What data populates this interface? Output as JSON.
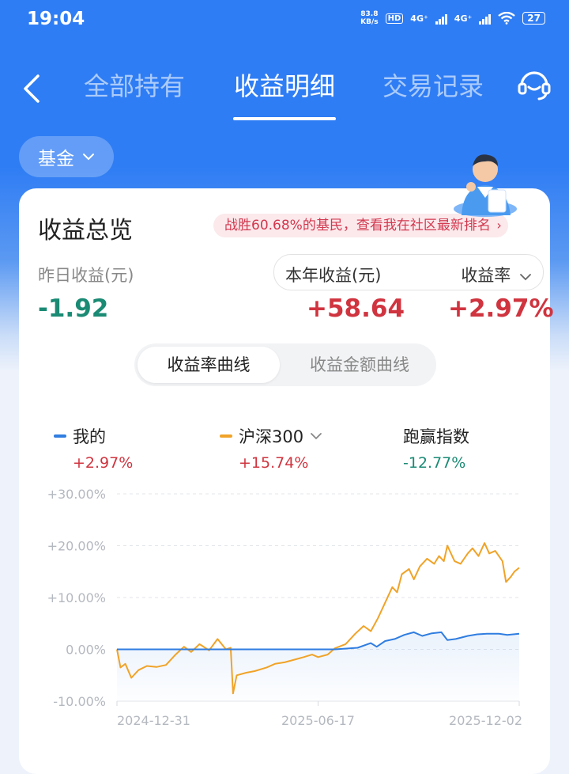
{
  "status_bar": {
    "time": "19:04",
    "net_speed_value": "83.8",
    "net_speed_unit": "KB/s",
    "hd_label": "HD",
    "sim1_label": "4G⁺",
    "sim2_label": "4G⁺",
    "battery": "27"
  },
  "nav": {
    "tabs": [
      {
        "label": "全部持有",
        "active": false
      },
      {
        "label": "收益明细",
        "active": true
      },
      {
        "label": "交易记录",
        "active": false
      }
    ]
  },
  "filter": {
    "label": "基金"
  },
  "overview": {
    "title": "收益总览",
    "rank_banner": "战胜60.68%的基民，查看我在社区最新排名",
    "yesterday_label": "昨日收益(元)",
    "yesterday_value": "-1.92",
    "year_label": "本年收益(元)",
    "rate_label": "收益率",
    "year_value": "+58.64",
    "rate_value": "+2.97%"
  },
  "curve_tabs": {
    "active": "收益率曲线",
    "inactive": "收益金额曲线"
  },
  "legend": [
    {
      "name": "我的",
      "value": "+2.97%",
      "color": "#2f7de1",
      "value_color": "#d0343f"
    },
    {
      "name": "沪深300",
      "value": "+15.74%",
      "color": "#f0a328",
      "value_color": "#d0343f"
    },
    {
      "name": "跑赢指数",
      "value": "-12.77%",
      "color": "",
      "value_color": "#1a8a74"
    }
  ],
  "chart_data": {
    "type": "line",
    "yticks": [
      "+30.00%",
      "+20.00%",
      "+10.00%",
      "0.00%",
      "-10.00%"
    ],
    "ylim": [
      -10,
      30
    ],
    "xticks": [
      "2024-12-31",
      "2025-06-17",
      "2025-12-02"
    ],
    "xrange": [
      "2024-12-31",
      "2025-12-02"
    ],
    "grid": true,
    "series": [
      {
        "name": "我的",
        "color": "#2f7de1",
        "points": [
          [
            "2024-12-31",
            0
          ],
          [
            "2025-07-01",
            0
          ],
          [
            "2025-07-20",
            0.3
          ],
          [
            "2025-07-31",
            1.2
          ],
          [
            "2025-08-05",
            0.5
          ],
          [
            "2025-08-12",
            1.6
          ],
          [
            "2025-08-20",
            2.0
          ],
          [
            "2025-08-28",
            2.8
          ],
          [
            "2025-09-05",
            3.3
          ],
          [
            "2025-09-12",
            2.6
          ],
          [
            "2025-09-20",
            3.1
          ],
          [
            "2025-09-28",
            3.3
          ],
          [
            "2025-10-03",
            1.8
          ],
          [
            "2025-10-10",
            2.0
          ],
          [
            "2025-10-20",
            2.6
          ],
          [
            "2025-10-28",
            2.9
          ],
          [
            "2025-11-05",
            3.0
          ],
          [
            "2025-11-15",
            3.0
          ],
          [
            "2025-11-22",
            2.8
          ],
          [
            "2025-12-02",
            3.0
          ]
        ]
      },
      {
        "name": "沪深300",
        "color": "#f0a328",
        "points": [
          [
            "2024-12-31",
            0
          ],
          [
            "2025-01-03",
            -3.5
          ],
          [
            "2025-01-07",
            -2.8
          ],
          [
            "2025-01-12",
            -5.5
          ],
          [
            "2025-01-18",
            -4.0
          ],
          [
            "2025-01-25",
            -3.2
          ],
          [
            "2025-02-02",
            -3.4
          ],
          [
            "2025-02-10",
            -3.0
          ],
          [
            "2025-02-18",
            -1.0
          ],
          [
            "2025-02-25",
            0.5
          ],
          [
            "2025-03-03",
            -0.5
          ],
          [
            "2025-03-10",
            1.0
          ],
          [
            "2025-03-18",
            -0.2
          ],
          [
            "2025-03-25",
            2.0
          ],
          [
            "2025-04-01",
            0.0
          ],
          [
            "2025-04-05",
            0.3
          ],
          [
            "2025-04-07",
            -8.5
          ],
          [
            "2025-04-10",
            -5.0
          ],
          [
            "2025-04-18",
            -4.5
          ],
          [
            "2025-04-25",
            -4.2
          ],
          [
            "2025-05-05",
            -3.5
          ],
          [
            "2025-05-12",
            -2.8
          ],
          [
            "2025-05-20",
            -2.5
          ],
          [
            "2025-05-28",
            -2.0
          ],
          [
            "2025-06-05",
            -1.5
          ],
          [
            "2025-06-12",
            -1.0
          ],
          [
            "2025-06-17",
            -1.5
          ],
          [
            "2025-06-25",
            -1.0
          ],
          [
            "2025-07-01",
            0.2
          ],
          [
            "2025-07-10",
            1.0
          ],
          [
            "2025-07-18",
            3.0
          ],
          [
            "2025-07-25",
            4.5
          ],
          [
            "2025-07-31",
            3.5
          ],
          [
            "2025-08-06",
            6.0
          ],
          [
            "2025-08-12",
            9.0
          ],
          [
            "2025-08-18",
            12.0
          ],
          [
            "2025-08-22",
            11.0
          ],
          [
            "2025-08-26",
            14.5
          ],
          [
            "2025-09-01",
            15.5
          ],
          [
            "2025-09-05",
            13.5
          ],
          [
            "2025-09-10",
            16.0
          ],
          [
            "2025-09-16",
            17.5
          ],
          [
            "2025-09-22",
            16.5
          ],
          [
            "2025-09-26",
            18.0
          ],
          [
            "2025-09-30",
            17.0
          ],
          [
            "2025-10-03",
            20.0
          ],
          [
            "2025-10-09",
            17.0
          ],
          [
            "2025-10-14",
            16.5
          ],
          [
            "2025-10-20",
            18.5
          ],
          [
            "2025-10-24",
            19.5
          ],
          [
            "2025-10-29",
            18.0
          ],
          [
            "2025-11-03",
            20.5
          ],
          [
            "2025-11-07",
            18.5
          ],
          [
            "2025-11-12",
            19.0
          ],
          [
            "2025-11-18",
            17.0
          ],
          [
            "2025-11-21",
            13.0
          ],
          [
            "2025-11-25",
            14.0
          ],
          [
            "2025-11-28",
            15.0
          ],
          [
            "2025-12-02",
            15.74
          ]
        ]
      }
    ]
  }
}
